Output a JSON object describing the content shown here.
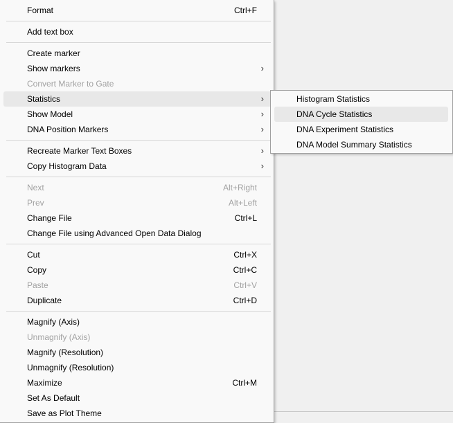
{
  "main_menu": {
    "groups": [
      [
        {
          "label": "Format",
          "shortcut": "Ctrl+F"
        }
      ],
      [
        {
          "label": "Add text box"
        }
      ],
      [
        {
          "label": "Create marker"
        },
        {
          "label": "Show markers",
          "submenu": true
        },
        {
          "label": "Convert Marker to Gate",
          "disabled": true
        },
        {
          "label": "Statistics",
          "submenu": true,
          "highlighted": true
        },
        {
          "label": "Show Model",
          "submenu": true
        },
        {
          "label": "DNA Position Markers",
          "submenu": true
        }
      ],
      [
        {
          "label": "Recreate Marker Text Boxes",
          "submenu": true
        },
        {
          "label": "Copy Histogram Data",
          "submenu": true
        }
      ],
      [
        {
          "label": "Next",
          "shortcut": "Alt+Right",
          "disabled": true
        },
        {
          "label": "Prev",
          "shortcut": "Alt+Left",
          "disabled": true
        },
        {
          "label": "Change File",
          "shortcut": "Ctrl+L"
        },
        {
          "label": "Change File using Advanced Open Data Dialog"
        }
      ],
      [
        {
          "label": "Cut",
          "shortcut": "Ctrl+X"
        },
        {
          "label": "Copy",
          "shortcut": "Ctrl+C"
        },
        {
          "label": "Paste",
          "shortcut": "Ctrl+V",
          "disabled": true
        },
        {
          "label": "Duplicate",
          "shortcut": "Ctrl+D"
        }
      ],
      [
        {
          "label": "Magnify (Axis)"
        },
        {
          "label": "Unmagnify (Axis)",
          "disabled": true
        },
        {
          "label": "Magnify (Resolution)"
        },
        {
          "label": "Unmagnify (Resolution)"
        },
        {
          "label": "Maximize",
          "shortcut": "Ctrl+M"
        },
        {
          "label": "Set As Default"
        },
        {
          "label": "Save as Plot Theme"
        }
      ]
    ]
  },
  "statistics_submenu": {
    "items": [
      {
        "label": "Histogram Statistics"
      },
      {
        "label": "DNA Cycle Statistics",
        "highlighted": true
      },
      {
        "label": "DNA Experiment Statistics"
      },
      {
        "label": "DNA Model Summary Statistics"
      }
    ]
  },
  "icons": {
    "submenu_arrow": "chevron-right-icon",
    "submenu_arrow_glyph": "›"
  },
  "colors": {
    "menu_background": "#f9f9f9",
    "highlight": "#e8e8e8",
    "disabled_text": "#a2a2a2",
    "separator": "#d7d7d7"
  }
}
